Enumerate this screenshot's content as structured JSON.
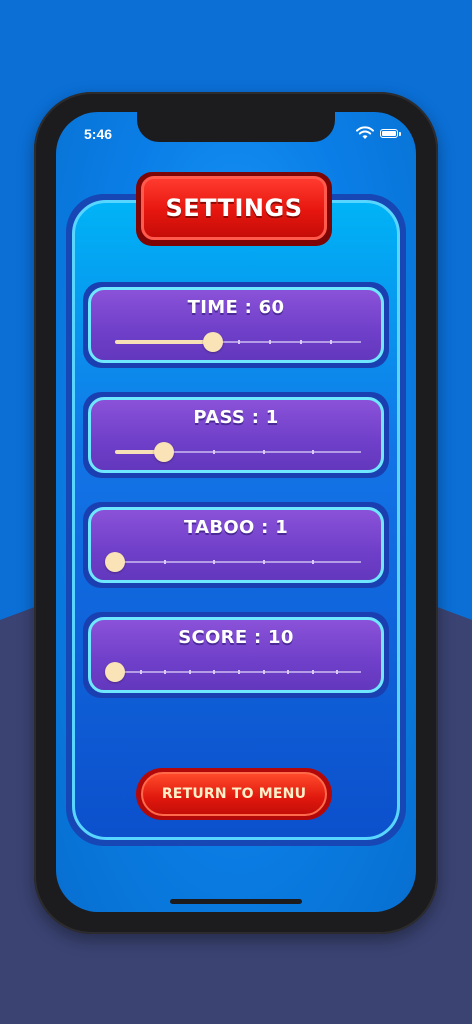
{
  "status_bar": {
    "time": "5:46",
    "wifi_icon": "wifi-icon",
    "battery_icon": "battery-icon"
  },
  "title": "SETTINGS",
  "sliders": [
    {
      "label": "TIME : 60",
      "fraction": 0.4,
      "ticks": 7
    },
    {
      "label": "PASS : 1",
      "fraction": 0.2,
      "ticks": 4
    },
    {
      "label": "TABOO : 1",
      "fraction": 0.0,
      "ticks": 4
    },
    {
      "label": "SCORE : 10",
      "fraction": 0.0,
      "ticks": 9
    }
  ],
  "return_button": "RETURN TO MENU",
  "colors": {
    "background": "#0b6fd6",
    "panel_border": "#59d6ff",
    "card": "#7446cc",
    "title_red": "#e6160f",
    "thumb": "#fbe3b8"
  }
}
